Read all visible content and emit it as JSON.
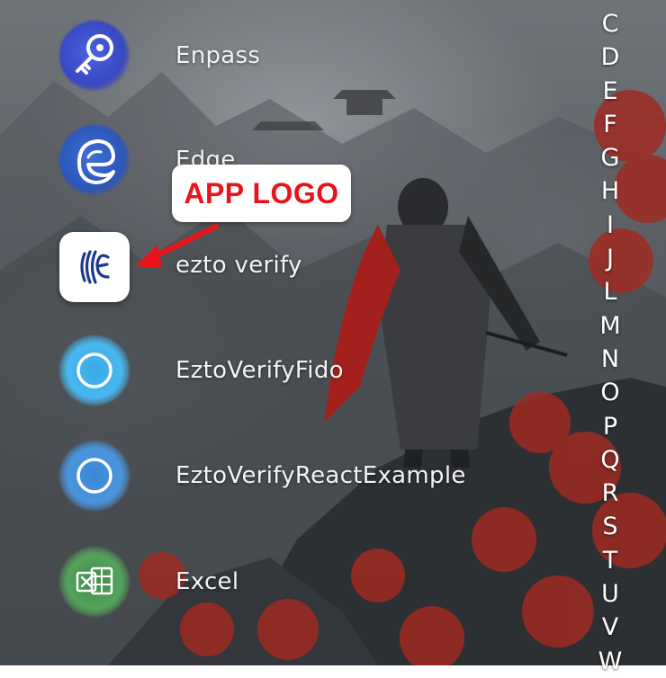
{
  "apps": [
    {
      "label": "Enpass",
      "icon": "key-icon"
    },
    {
      "label": "Edge",
      "icon": "edge-icon"
    },
    {
      "label": "ezto verify",
      "icon": "ezto-verify-logo-icon"
    },
    {
      "label": "EztoVerifyFido",
      "icon": "circle-icon"
    },
    {
      "label": "EztoVerifyReactExample",
      "icon": "circle-icon"
    },
    {
      "label": "Excel",
      "icon": "excel-icon"
    }
  ],
  "alphabet": [
    "C",
    "D",
    "E",
    "F",
    "G",
    "H",
    "I",
    "J",
    "L",
    "M",
    "N",
    "O",
    "P",
    "Q",
    "R",
    "S",
    "T",
    "U",
    "V",
    "W"
  ],
  "annotation": {
    "label": "APP LOGO",
    "color": "#e8141b"
  }
}
